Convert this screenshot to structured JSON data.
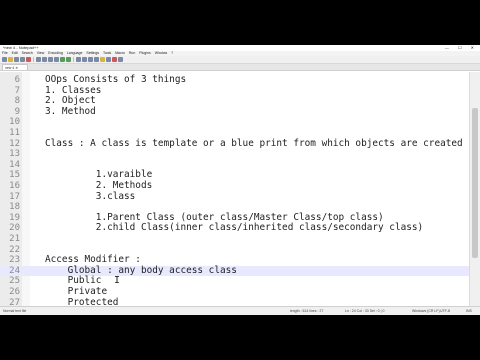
{
  "window": {
    "title": "*new 4 - Notepad++",
    "controls": "— ☐ ✕"
  },
  "menu": [
    "File",
    "Edit",
    "Search",
    "View",
    "Encoding",
    "Language",
    "Settings",
    "Tools",
    "Macro",
    "Run",
    "Plugins",
    "Window",
    "?"
  ],
  "tab": {
    "label": "new 4 ✕"
  },
  "editor": {
    "lines": [
      {
        "n": "6",
        "text": "OOps Consists of 3 things"
      },
      {
        "n": "7",
        "text": "1. Classes"
      },
      {
        "n": "8",
        "text": "2. Object"
      },
      {
        "n": "9",
        "text": "3. Method"
      },
      {
        "n": "10",
        "text": ""
      },
      {
        "n": "11",
        "text": ""
      },
      {
        "n": "12",
        "text": "Class : A class is template or a blue print from which objects are created"
      },
      {
        "n": "13",
        "text": ""
      },
      {
        "n": "14",
        "text": ""
      },
      {
        "n": "15",
        "text": "         1.varaible"
      },
      {
        "n": "16",
        "text": "         2. Methods"
      },
      {
        "n": "17",
        "text": "         3.class"
      },
      {
        "n": "18",
        "text": ""
      },
      {
        "n": "19",
        "text": "         1.Parent Class (outer class/Master Class/top class)"
      },
      {
        "n": "20",
        "text": "         2.child Class(inner class/inherited class/secondary class)"
      },
      {
        "n": "21",
        "text": ""
      },
      {
        "n": "22",
        "text": ""
      },
      {
        "n": "23",
        "text": "Access Modifier :"
      },
      {
        "n": "24",
        "text": "    Global : any body access class"
      },
      {
        "n": "25",
        "text": "    Public"
      },
      {
        "n": "26",
        "text": "    Private"
      },
      {
        "n": "27",
        "text": "    Protected"
      }
    ],
    "current_line_index": 18
  },
  "status": {
    "type": "Normal text file",
    "length": "length : 614    lines : 27",
    "position": "Ln : 24    Col : 33    Sel : 0 | 0",
    "eol": "Windows (CR LF)",
    "encoding": "UTF-8",
    "mode": "INS"
  }
}
